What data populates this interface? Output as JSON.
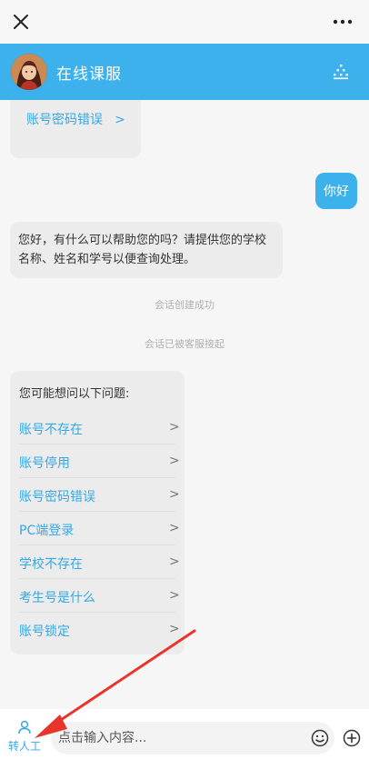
{
  "header": {
    "title": "在线课服"
  },
  "messages": {
    "top_link": "账号密码错误",
    "user_message": "你好",
    "bot_reply": "您好，有什么可以帮助您的吗？请提供您的学校名称、姓名和学号以便查询处理。",
    "sys_session_created": "会话创建成功",
    "sys_agent_accepted": "会话已被客服接起"
  },
  "faq": {
    "title": "您可能想问以下问题:",
    "items": [
      {
        "label": "账号不存在"
      },
      {
        "label": "账号停用"
      },
      {
        "label": "账号密码错误"
      },
      {
        "label": "PC端登录"
      },
      {
        "label": "学校不存在"
      },
      {
        "label": "考生号是什么"
      },
      {
        "label": "账号锁定"
      }
    ]
  },
  "bottom": {
    "human_label": "转人工",
    "input_placeholder": "点击输入内容..."
  },
  "colors": {
    "brand_blue": "#3cb1ec",
    "link_blue": "#36a8e6",
    "arrow_red": "#e8352b"
  },
  "icons": {
    "close": "close-icon",
    "more": "more-dots-icon",
    "menu": "tree-menu-icon",
    "person": "person-icon",
    "emoji": "emoji-icon",
    "plus": "plus-circle-icon",
    "chevron": "chevron-right-icon"
  }
}
